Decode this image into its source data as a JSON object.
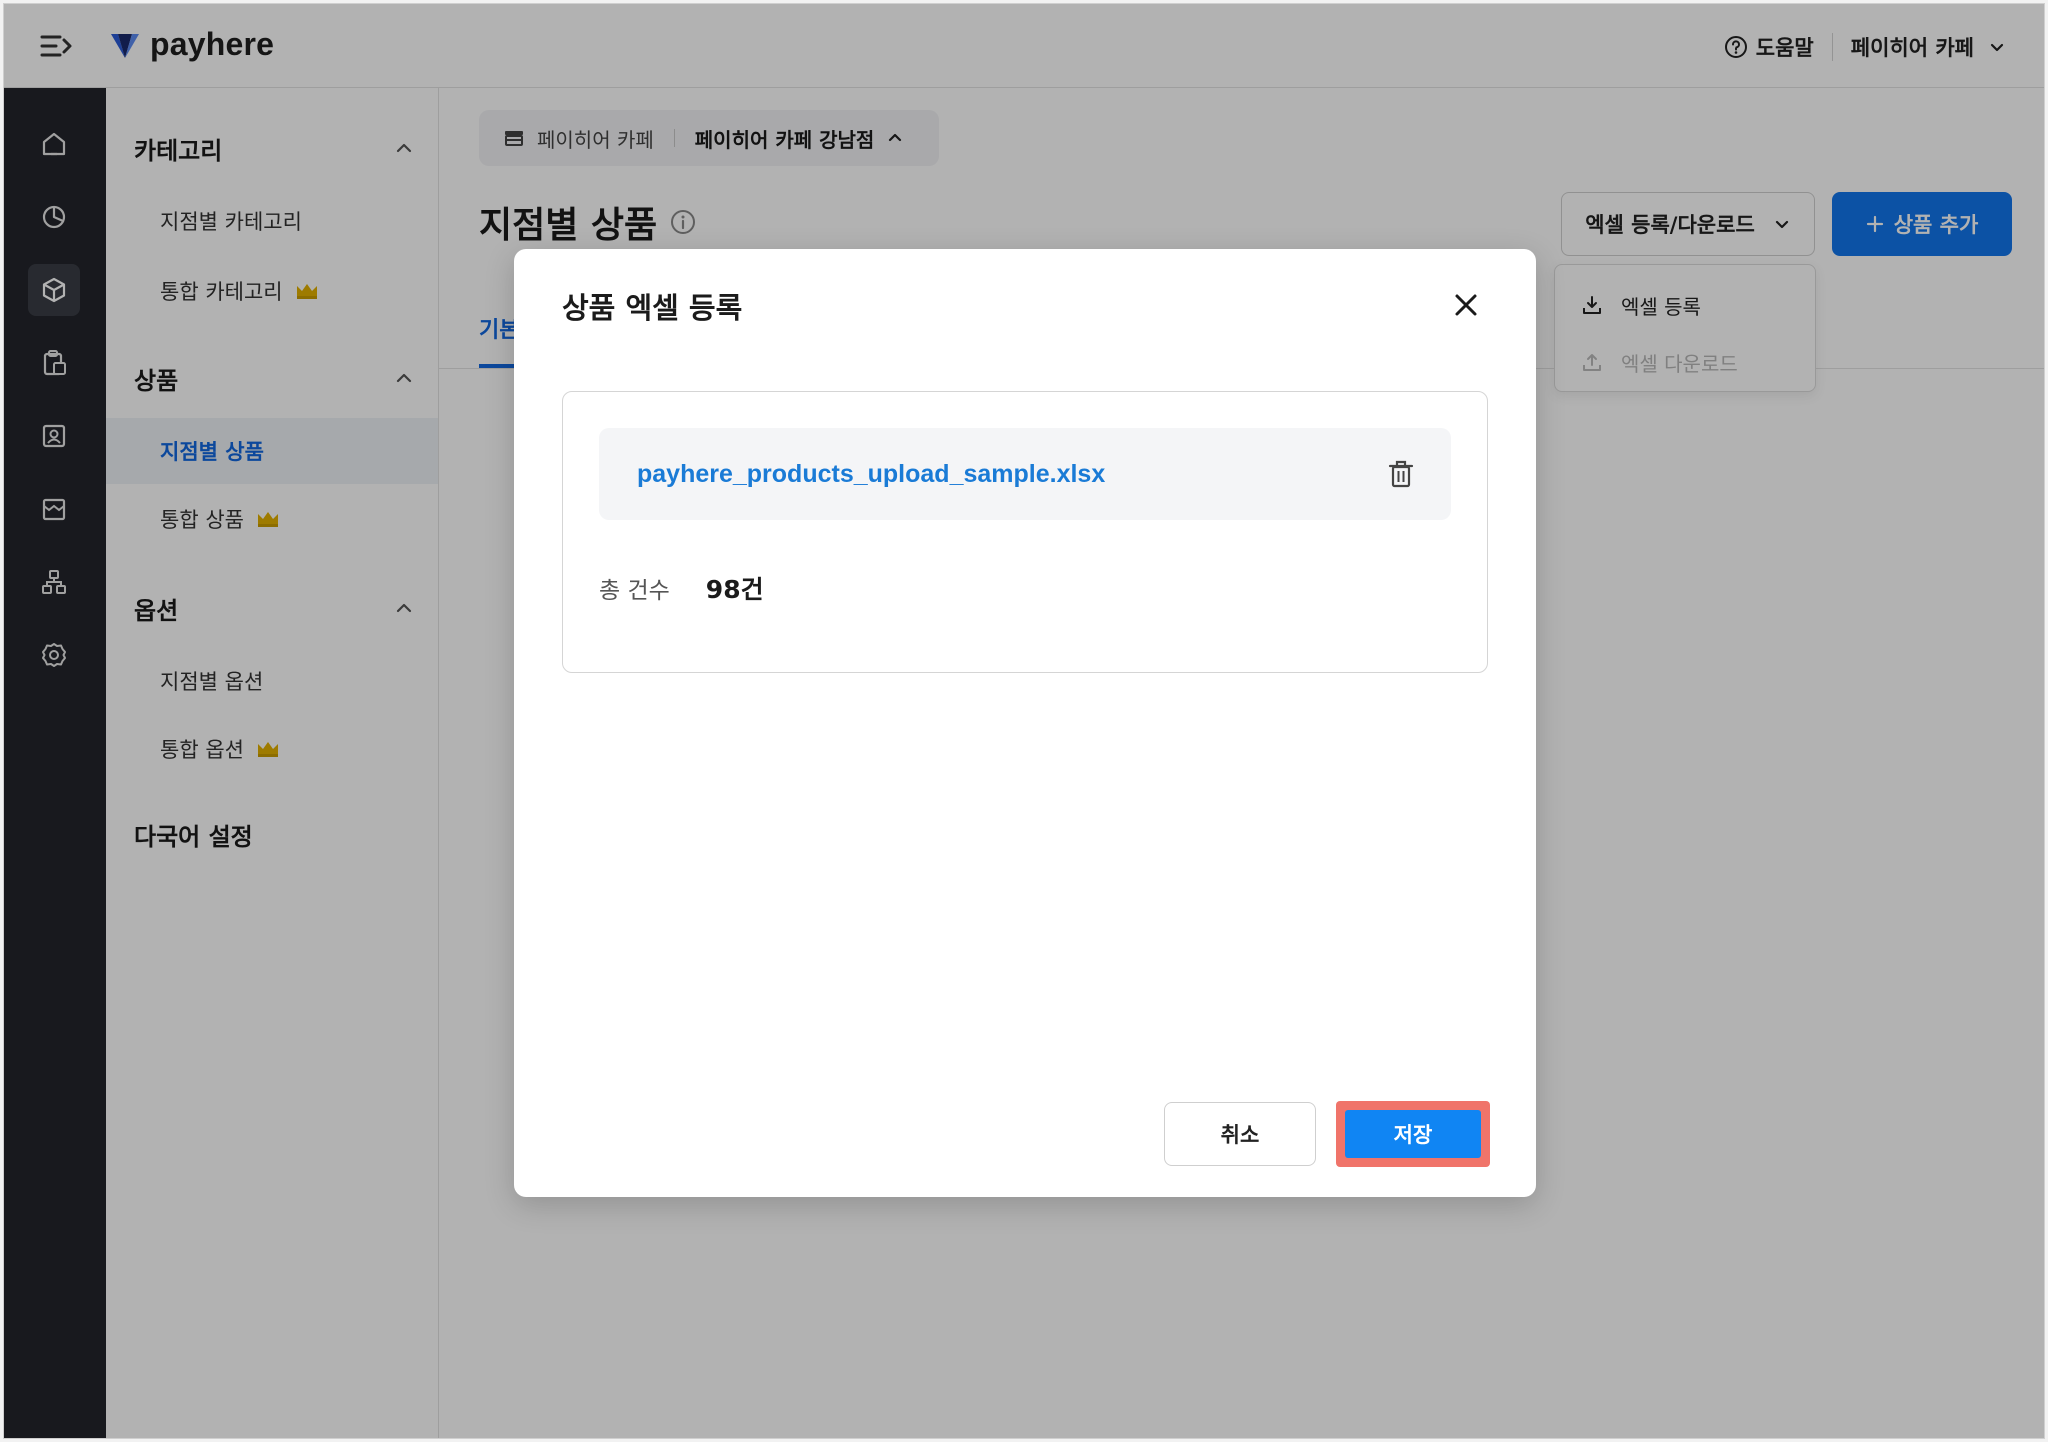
{
  "header": {
    "brand": "payhere",
    "help_label": "도움말",
    "store_label": "페이히어 카페"
  },
  "rail": {
    "icons": [
      "home-icon",
      "chart-icon",
      "cube-icon",
      "clipboard-icon",
      "user-card-icon",
      "store-icon",
      "org-icon",
      "gear-icon"
    ]
  },
  "sidebar": {
    "sections": [
      {
        "title": "카테고리",
        "items": [
          "지점별 카테고리",
          "통합 카테고리"
        ]
      },
      {
        "title": "상품",
        "items": [
          "지점별 상품",
          "통합 상품"
        ]
      },
      {
        "title": "옵션",
        "items": [
          "지점별 옵션",
          "통합 옵션"
        ]
      },
      {
        "title": "다국어 설정",
        "items": []
      }
    ],
    "active_item": "지점별 상품"
  },
  "main": {
    "breadcrumb": {
      "org": "페이히어 카페",
      "store": "페이히어 카페 강남점"
    },
    "page_title": "지점별 상품",
    "tab_partial": "기본",
    "excel_button": "엑셀 등록/다운로드",
    "add_button": "상품 추가",
    "dropdown": {
      "upload": "엑셀 등록",
      "download": "엑셀 다운로드"
    }
  },
  "modal": {
    "title": "상품 엑셀 등록",
    "file_name": "payhere_products_upload_sample.xlsx",
    "count_label": "총 건수",
    "count_value": "98건",
    "cancel_label": "취소",
    "save_label": "저장"
  },
  "colors": {
    "brand_blue": "#1276ec",
    "link_blue": "#1a7bd6",
    "rail_dark": "#23252b",
    "crown_gold": "#e2b100",
    "highlight": "#f0746a"
  }
}
